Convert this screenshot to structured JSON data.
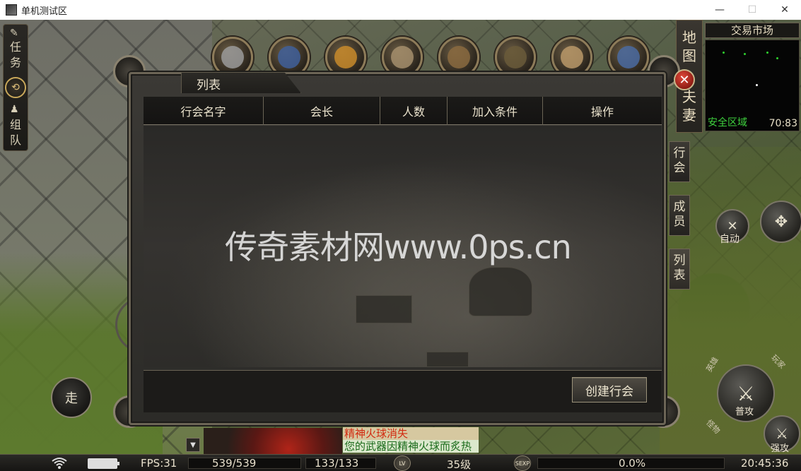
{
  "window": {
    "title": "单机测试区",
    "minimize_glyph": "—",
    "maximize_glyph": "☐",
    "close_glyph": "✕"
  },
  "left_panel": {
    "quest_label_1": "任",
    "quest_label_2": "务",
    "team_label_1": "组",
    "team_label_2": "队",
    "quest_icon": "scroll-icon",
    "team_icon": "people-icon",
    "toggle_icon": "refresh-icon"
  },
  "top_icons": [
    "return-icon",
    "skill-book-icon",
    "guild-flag-icon",
    "horse-icon",
    "character-icon",
    "backpack-icon",
    "friends-handshake-icon",
    "mail-icon"
  ],
  "map": {
    "tab_label_1": "地",
    "tab_label_2": "图",
    "title": "交易市场",
    "zone": "安全区域",
    "coords": "70:83",
    "marriage_label_1": "夫",
    "marriage_label_2": "妻"
  },
  "dialog": {
    "title": "列表",
    "columns": [
      "行会名字",
      "会长",
      "人数",
      "加入条件",
      "操作"
    ],
    "rows": [],
    "create_button": "创建行会",
    "close_glyph": "✕",
    "side_tabs": [
      {
        "line1": "行",
        "line2": "会"
      },
      {
        "line1": "成",
        "line2": "员"
      },
      {
        "line1": "列",
        "line2": "表"
      }
    ]
  },
  "watermark": "传奇素材网www.0ps.cn",
  "controls": {
    "walk": "走",
    "auto": "自动",
    "attack": "普攻",
    "strong_attack": "强攻",
    "ring_hero": "英雄",
    "ring_player": "玩家",
    "ring_monster": "怪物",
    "move_icon": "four-arrows-icon",
    "sword_icon": "sword-icon"
  },
  "chat": {
    "line1": "精神火球消失",
    "line2": "您的武器因精神火球而炙热",
    "expand_glyph": "▼"
  },
  "statusbar": {
    "fps": "FPS:31",
    "hp": "539/539",
    "mp": "133/133",
    "lv_badge": "LV",
    "level": "35级",
    "exp_badge": "SEXP",
    "exp": "0.0%",
    "time": "20:45:36"
  },
  "colors": {
    "safe_zone": "#3ed23e",
    "chat_red": "#e03018",
    "chat_green": "#1c6c1c",
    "close_red": "#c6281b"
  }
}
